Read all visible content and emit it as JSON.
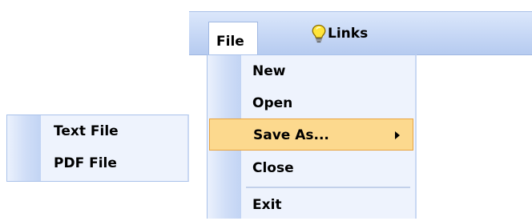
{
  "menubar": {
    "file_label": "File",
    "links_label": "Links",
    "links_icon": "lightbulb-icon"
  },
  "file_menu": {
    "items": [
      {
        "label": "New"
      },
      {
        "label": "Open"
      },
      {
        "label": "Save As...",
        "highlighted": true,
        "has_submenu": true
      },
      {
        "label": "Close"
      },
      {
        "label": "Exit"
      }
    ]
  },
  "save_as_menu": {
    "items": [
      {
        "label": "Text File"
      },
      {
        "label": "PDF File"
      }
    ]
  },
  "colors": {
    "menubar_gradient_top": "#dbe7fb",
    "menubar_gradient_bottom": "#b6cbf0",
    "menu_background": "#eef3fd",
    "highlight_fill": "#fcd98e",
    "highlight_border": "#e9a440"
  }
}
